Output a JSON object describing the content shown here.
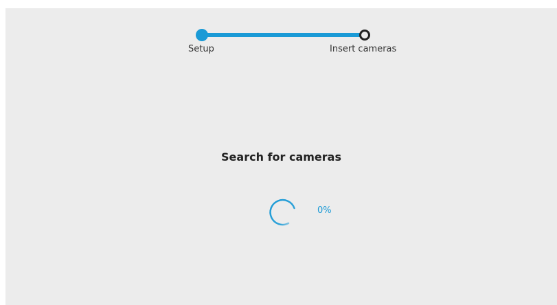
{
  "stepper": {
    "steps": [
      {
        "label": "Setup",
        "status": "completed"
      },
      {
        "label": "Insert cameras",
        "status": "current"
      }
    ]
  },
  "search": {
    "title": "Search for cameras",
    "progress_text": "0%",
    "progress_value": 0
  },
  "colors": {
    "accent": "#1a9ad6",
    "background": "#ececec",
    "text": "#222222"
  },
  "icons": {
    "spinner": "loading-spinner-icon"
  }
}
